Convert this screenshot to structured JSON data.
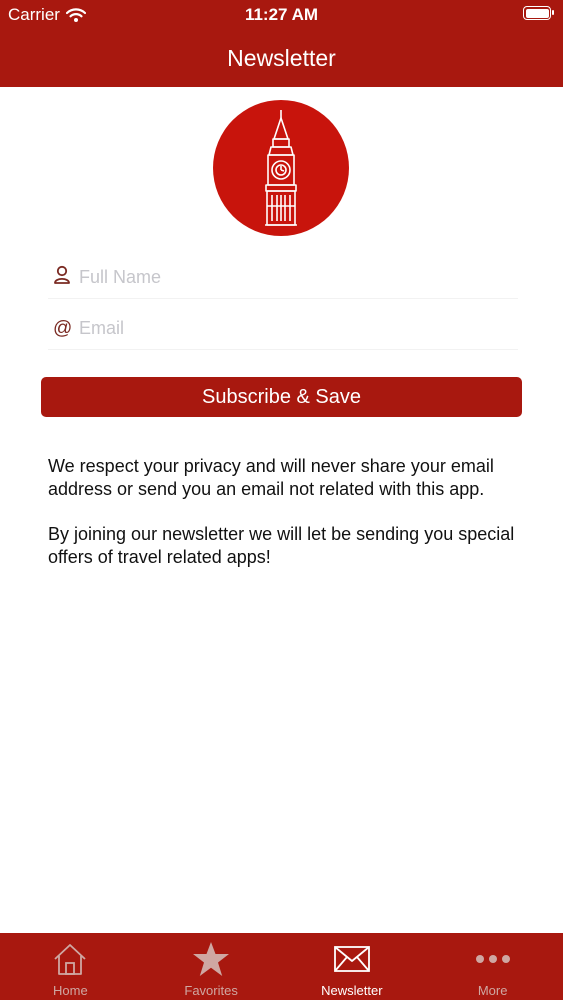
{
  "status_bar": {
    "carrier": "Carrier",
    "time": "11:27 AM"
  },
  "nav": {
    "title": "Newsletter"
  },
  "form": {
    "full_name": {
      "placeholder": "Full Name",
      "value": ""
    },
    "email": {
      "placeholder": "Email",
      "value": ""
    },
    "subscribe_label": "Subscribe & Save"
  },
  "privacy": {
    "paragraph1": "We respect your privacy and will never share your email address or send you an email not related with this app.",
    "paragraph2": "By joining our newsletter we will let be sending you special offers of travel related apps!"
  },
  "tabs": [
    {
      "label": "Home",
      "icon": "home-icon",
      "active": false
    },
    {
      "label": "Favorites",
      "icon": "star-icon",
      "active": false
    },
    {
      "label": "Newsletter",
      "icon": "envelope-icon",
      "active": true
    },
    {
      "label": "More",
      "icon": "more-icon",
      "active": false
    }
  ],
  "colors": {
    "brand": "#a8180f",
    "logo_circle": "#c8140c",
    "tab_inactive": "#cfa7a2",
    "placeholder": "#c6c6cb"
  }
}
